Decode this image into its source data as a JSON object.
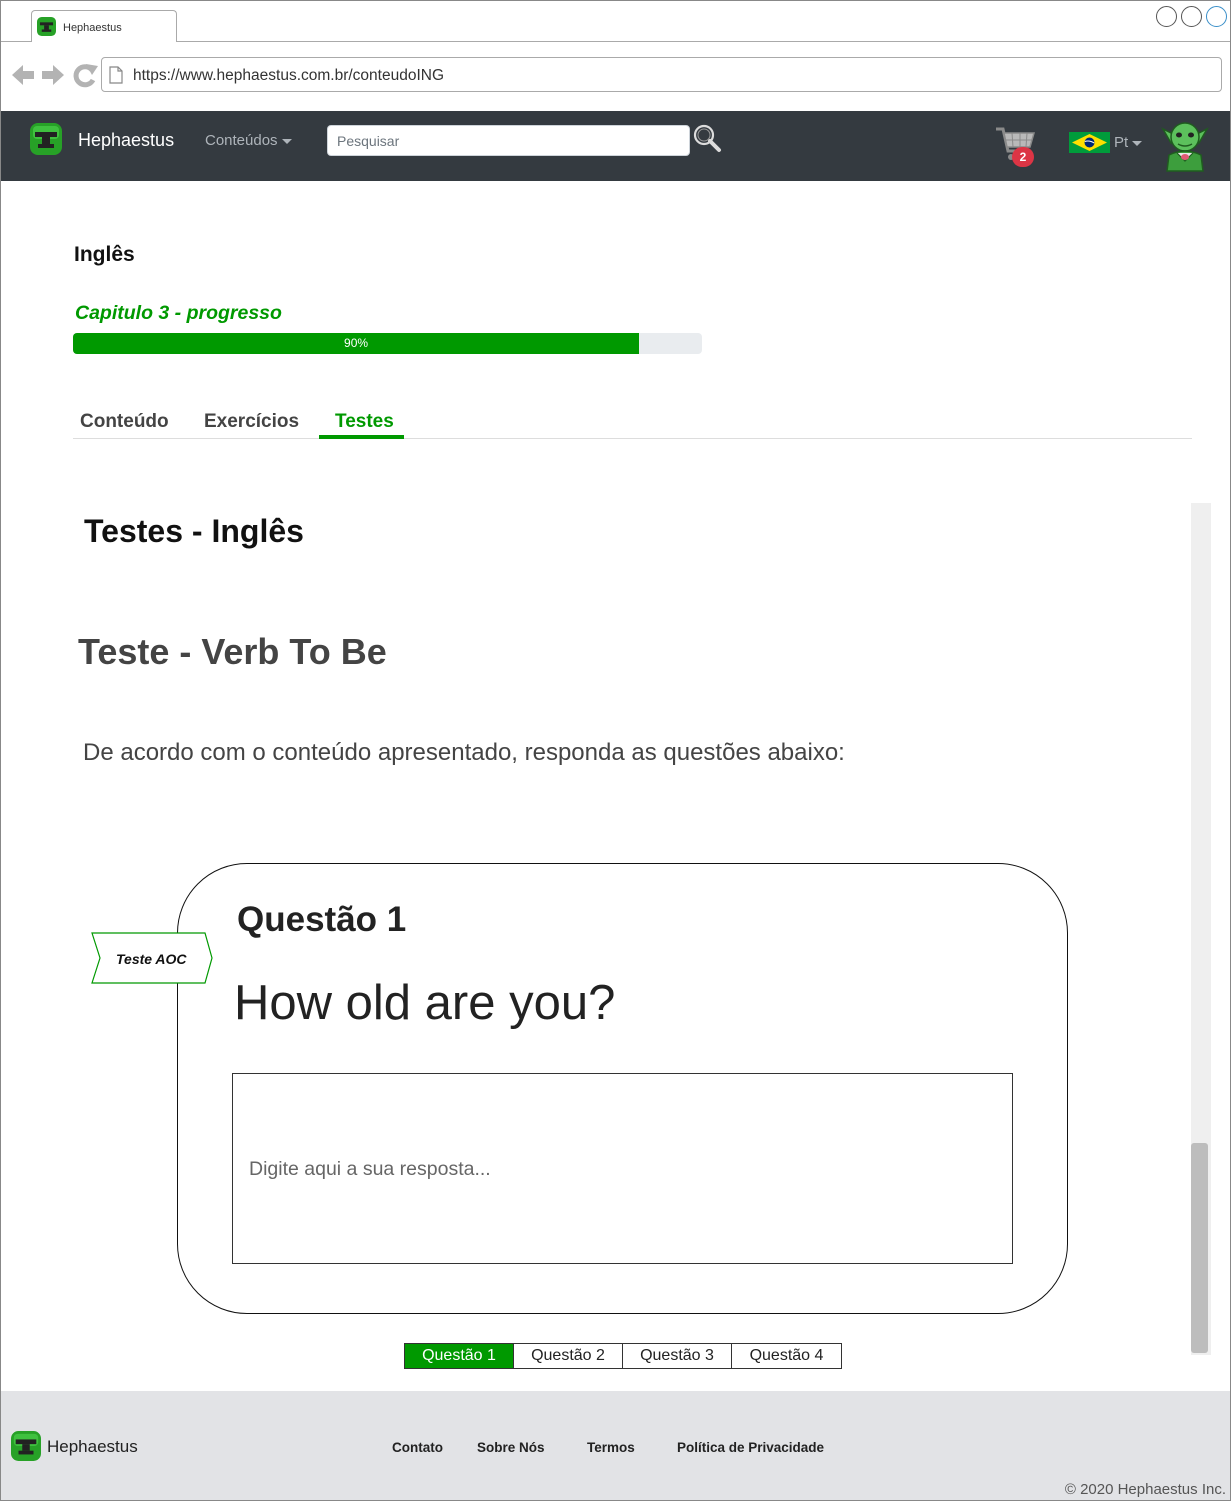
{
  "browser": {
    "tab_title": "Hephaestus",
    "url": "https://www.hephaestus.com.br/conteudoING"
  },
  "navbar": {
    "brand": "Hephaestus",
    "menu_label": "Conteúdos",
    "search_placeholder": "Pesquisar",
    "cart_count": "2",
    "language": "Pt"
  },
  "main": {
    "subject": "Inglês",
    "progress_title": "Capitulo 3 - progresso",
    "progress_percent": 90,
    "progress_label": "90%",
    "tabs": [
      {
        "label": "Conteúdo"
      },
      {
        "label": "Exercícios"
      },
      {
        "label": "Testes",
        "active": true
      }
    ],
    "tests_title": "Testes - Inglês",
    "test_name": "Teste - Verb To Be",
    "instructions": "De acordo com o conteúdo apresentado, responda as questões abaixo:",
    "question": {
      "tag": "Teste AOC",
      "label": "Questão 1",
      "text": "How old are you?",
      "answer_placeholder": "Digite aqui a sua resposta..."
    },
    "pager": [
      "Questão 1",
      "Questão 2",
      "Questão 3",
      "Questão 4"
    ],
    "pager_active": 0
  },
  "footer": {
    "brand": "Hephaestus",
    "links": [
      "Contato",
      "Sobre Nós",
      "Termos",
      "Política de Privacidade"
    ],
    "copyright": "© 2020 Hephaestus Inc."
  },
  "colors": {
    "accent": "#009900",
    "navbar": "#343a40",
    "badge": "#dc3545",
    "footer": "#e2e3e6"
  }
}
